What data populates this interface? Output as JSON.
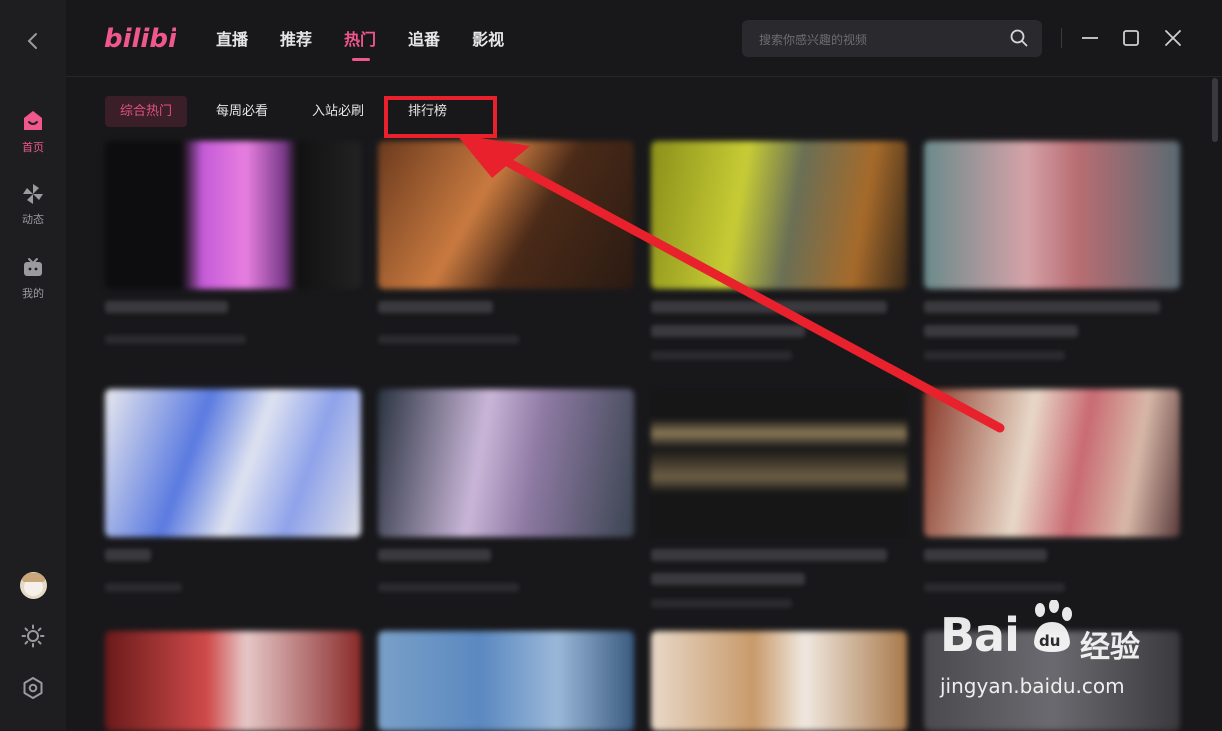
{
  "app": {
    "logo_text": "bilibili"
  },
  "sidebar": {
    "items": [
      {
        "label": "首页",
        "icon": "home-tv-icon",
        "active": true
      },
      {
        "label": "动态",
        "icon": "pinwheel-icon",
        "active": false
      },
      {
        "label": "我的",
        "icon": "tv-face-icon",
        "active": false
      }
    ]
  },
  "nav": {
    "items": [
      {
        "label": "直播"
      },
      {
        "label": "推荐"
      },
      {
        "label": "热门"
      },
      {
        "label": "追番"
      },
      {
        "label": "影视"
      }
    ],
    "active_index": 2
  },
  "search": {
    "placeholder": "搜索你感兴趣的视频"
  },
  "tabs": {
    "items": [
      {
        "label": "综合热门"
      },
      {
        "label": "每周必看"
      },
      {
        "label": "入站必刷"
      },
      {
        "label": "排行榜"
      }
    ],
    "active_index": 0
  },
  "watermark": {
    "brand": "Bai",
    "brand_cn": "经验",
    "url": "jingyan.baidu.com"
  },
  "colors": {
    "accent": "#f0588b",
    "annotation": "#e8212c",
    "background": "#18181b"
  }
}
